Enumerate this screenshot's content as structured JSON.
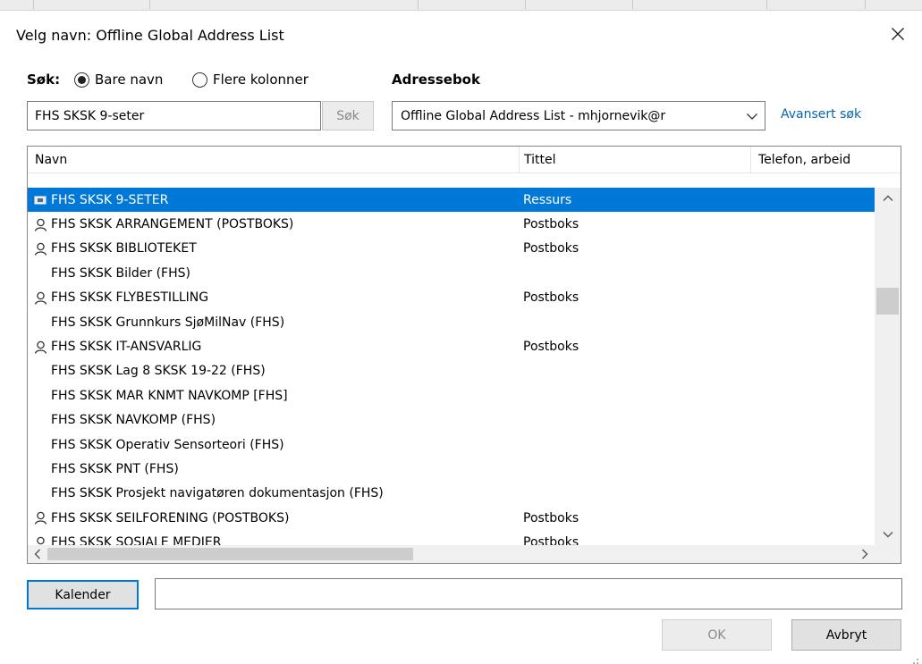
{
  "window": {
    "title": "Velg navn: Offline Global Address List"
  },
  "search": {
    "label": "Søk:",
    "options": [
      {
        "label": "Bare navn",
        "selected": true
      },
      {
        "label": "Flere kolonner",
        "selected": false
      }
    ],
    "value": "FHS SKSK 9-seter",
    "button_label": "Søk"
  },
  "addressbook": {
    "label": "Adressebok",
    "selected": "Offline Global Address List - mhjornevik@r",
    "advanced_link": "Avansert søk"
  },
  "list": {
    "columns": [
      "Navn",
      "Tittel",
      "Telefon, arbeid"
    ],
    "rows": [
      {
        "icon": "room-icon",
        "name": "FHS SKSK 9-SETER",
        "title": "Ressurs",
        "selected": true
      },
      {
        "icon": "person-icon",
        "name": "FHS SKSK ARRANGEMENT (POSTBOKS)",
        "title": "Postboks",
        "selected": false
      },
      {
        "icon": "person-icon",
        "name": "FHS SKSK BIBLIOTEKET",
        "title": "Postboks",
        "selected": false
      },
      {
        "icon": "",
        "name": "FHS SKSK Bilder (FHS)",
        "title": "",
        "selected": false
      },
      {
        "icon": "person-icon",
        "name": "FHS SKSK FLYBESTILLING",
        "title": "Postboks",
        "selected": false
      },
      {
        "icon": "",
        "name": "FHS SKSK Grunnkurs SjøMilNav (FHS)",
        "title": "",
        "selected": false
      },
      {
        "icon": "person-icon",
        "name": "FHS SKSK IT-ANSVARLIG",
        "title": "Postboks",
        "selected": false
      },
      {
        "icon": "",
        "name": "FHS SKSK Lag 8 SKSK 19-22 (FHS)",
        "title": "",
        "selected": false
      },
      {
        "icon": "",
        "name": "FHS SKSK MAR KNMT NAVKOMP [FHS]",
        "title": "",
        "selected": false
      },
      {
        "icon": "",
        "name": "FHS SKSK NAVKOMP (FHS)",
        "title": "",
        "selected": false
      },
      {
        "icon": "",
        "name": "FHS SKSK Operativ Sensorteori (FHS)",
        "title": "",
        "selected": false
      },
      {
        "icon": "",
        "name": "FHS SKSK PNT (FHS)",
        "title": "",
        "selected": false
      },
      {
        "icon": "",
        "name": "FHS SKSK Prosjekt navigatøren dokumentasjon (FHS)",
        "title": "",
        "selected": false
      },
      {
        "icon": "person-icon",
        "name": "FHS SKSK SEILFORENING (POSTBOKS)",
        "title": "Postboks",
        "selected": false
      },
      {
        "icon": "person-icon",
        "name": "FHS SKSK SOSIALE MEDIER",
        "title": "Postboks",
        "selected": false
      }
    ]
  },
  "bottom": {
    "recipient_button": "Kalender",
    "recipient_value": "",
    "ok_label": "OK",
    "cancel_label": "Avbryt"
  },
  "colors": {
    "selection": "#0078d7",
    "link": "#0a64ad",
    "disabled_text": "#8a8a8a"
  }
}
